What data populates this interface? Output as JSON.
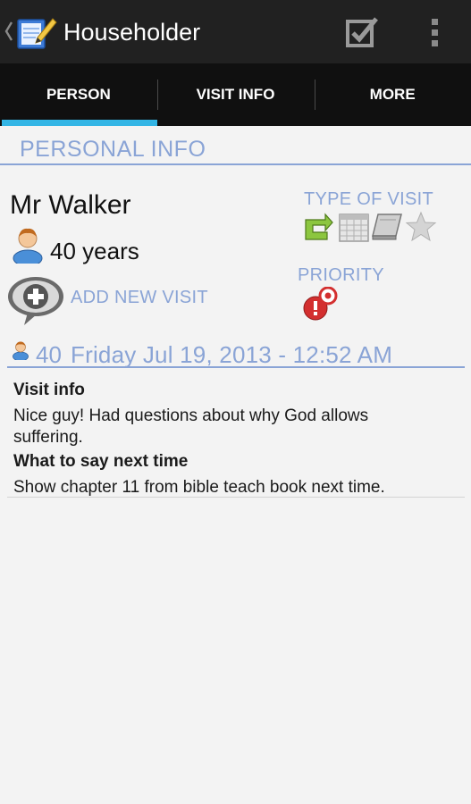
{
  "actionbar": {
    "title": "Householder",
    "up_icon": "chevron-left-icon",
    "app_icon": "notepad-pencil-icon",
    "edit_icon": "checkbox-edit-icon",
    "overflow_icon": "overflow-menu-icon"
  },
  "tabs": [
    {
      "label": "PERSON",
      "selected": true
    },
    {
      "label": "VISIT INFO",
      "selected": false
    },
    {
      "label": "MORE",
      "selected": false
    }
  ],
  "section": {
    "title": "PERSONAL INFO"
  },
  "person": {
    "name": "Mr Walker",
    "age": "40 years",
    "add_visit_label": "ADD NEW VISIT"
  },
  "type_of_visit": {
    "label": "TYPE OF VISIT",
    "icons": [
      "return-visit-icon",
      "calendar-icon",
      "book-icon",
      "star-icon"
    ]
  },
  "priority": {
    "label": "PRIORITY",
    "icon": "priority-alert-icon"
  },
  "visit": {
    "age": "40",
    "date": "Friday Jul 19, 2013 - 12:52 AM",
    "info_label": "Visit info",
    "info_text": "Nice guy! Had questions about why God allows suffering.",
    "next_label": "What to say next time",
    "next_text": "Show chapter 11 from bible teach book next time."
  },
  "colors": {
    "accent": "#33b5e5",
    "header_text": "#8aa4d6",
    "actionbar_bg": "#212121",
    "tabs_bg": "#101010",
    "page_bg": "#f3f3f3"
  }
}
